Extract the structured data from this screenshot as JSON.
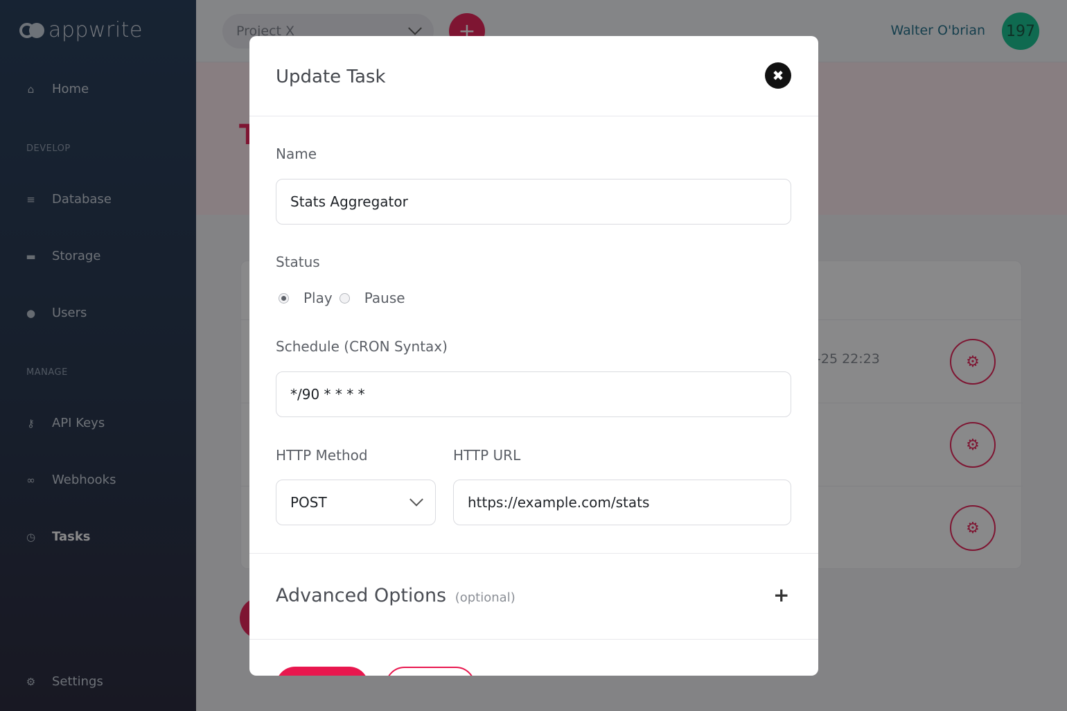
{
  "sidebar": {
    "logo_text": "appwrite",
    "sections": {
      "develop": "DEVELOP",
      "manage": "MANAGE"
    },
    "items": [
      {
        "label": "Home"
      },
      {
        "label": "Database"
      },
      {
        "label": "Storage"
      },
      {
        "label": "Users"
      },
      {
        "label": "API Keys"
      },
      {
        "label": "Webhooks"
      },
      {
        "label": "Tasks"
      },
      {
        "label": "Settings"
      }
    ],
    "active": "Tasks"
  },
  "topbar": {
    "project": "Project X",
    "add_label": "+",
    "user_name": "Walter O'brian",
    "avatar_text": "197"
  },
  "page": {
    "title_visible": "T",
    "rows": [
      {
        "date": "-25 22:23"
      },
      {
        "date": ""
      },
      {
        "date": ""
      }
    ]
  },
  "modal": {
    "title": "Update Task",
    "close_label": "✖",
    "name_label": "Name",
    "name_value": "Stats Aggregator",
    "status_label": "Status",
    "status_options": [
      "Play",
      "Pause"
    ],
    "status_selected": "Play",
    "schedule_label": "Schedule (CRON Syntax)",
    "schedule_value": "*/90 * * * *",
    "http_method_label": "HTTP Method",
    "http_method_value": "POST",
    "http_url_label": "HTTP URL",
    "http_url_value": "https://example.com/stats",
    "advanced_label": "Advanced Options",
    "advanced_optional": "(optional)",
    "advanced_toggle": "+"
  },
  "colors": {
    "accent": "#e8174e",
    "sidebar": "#1b3350",
    "avatar": "#0bc18a",
    "user_name": "#186a85"
  }
}
